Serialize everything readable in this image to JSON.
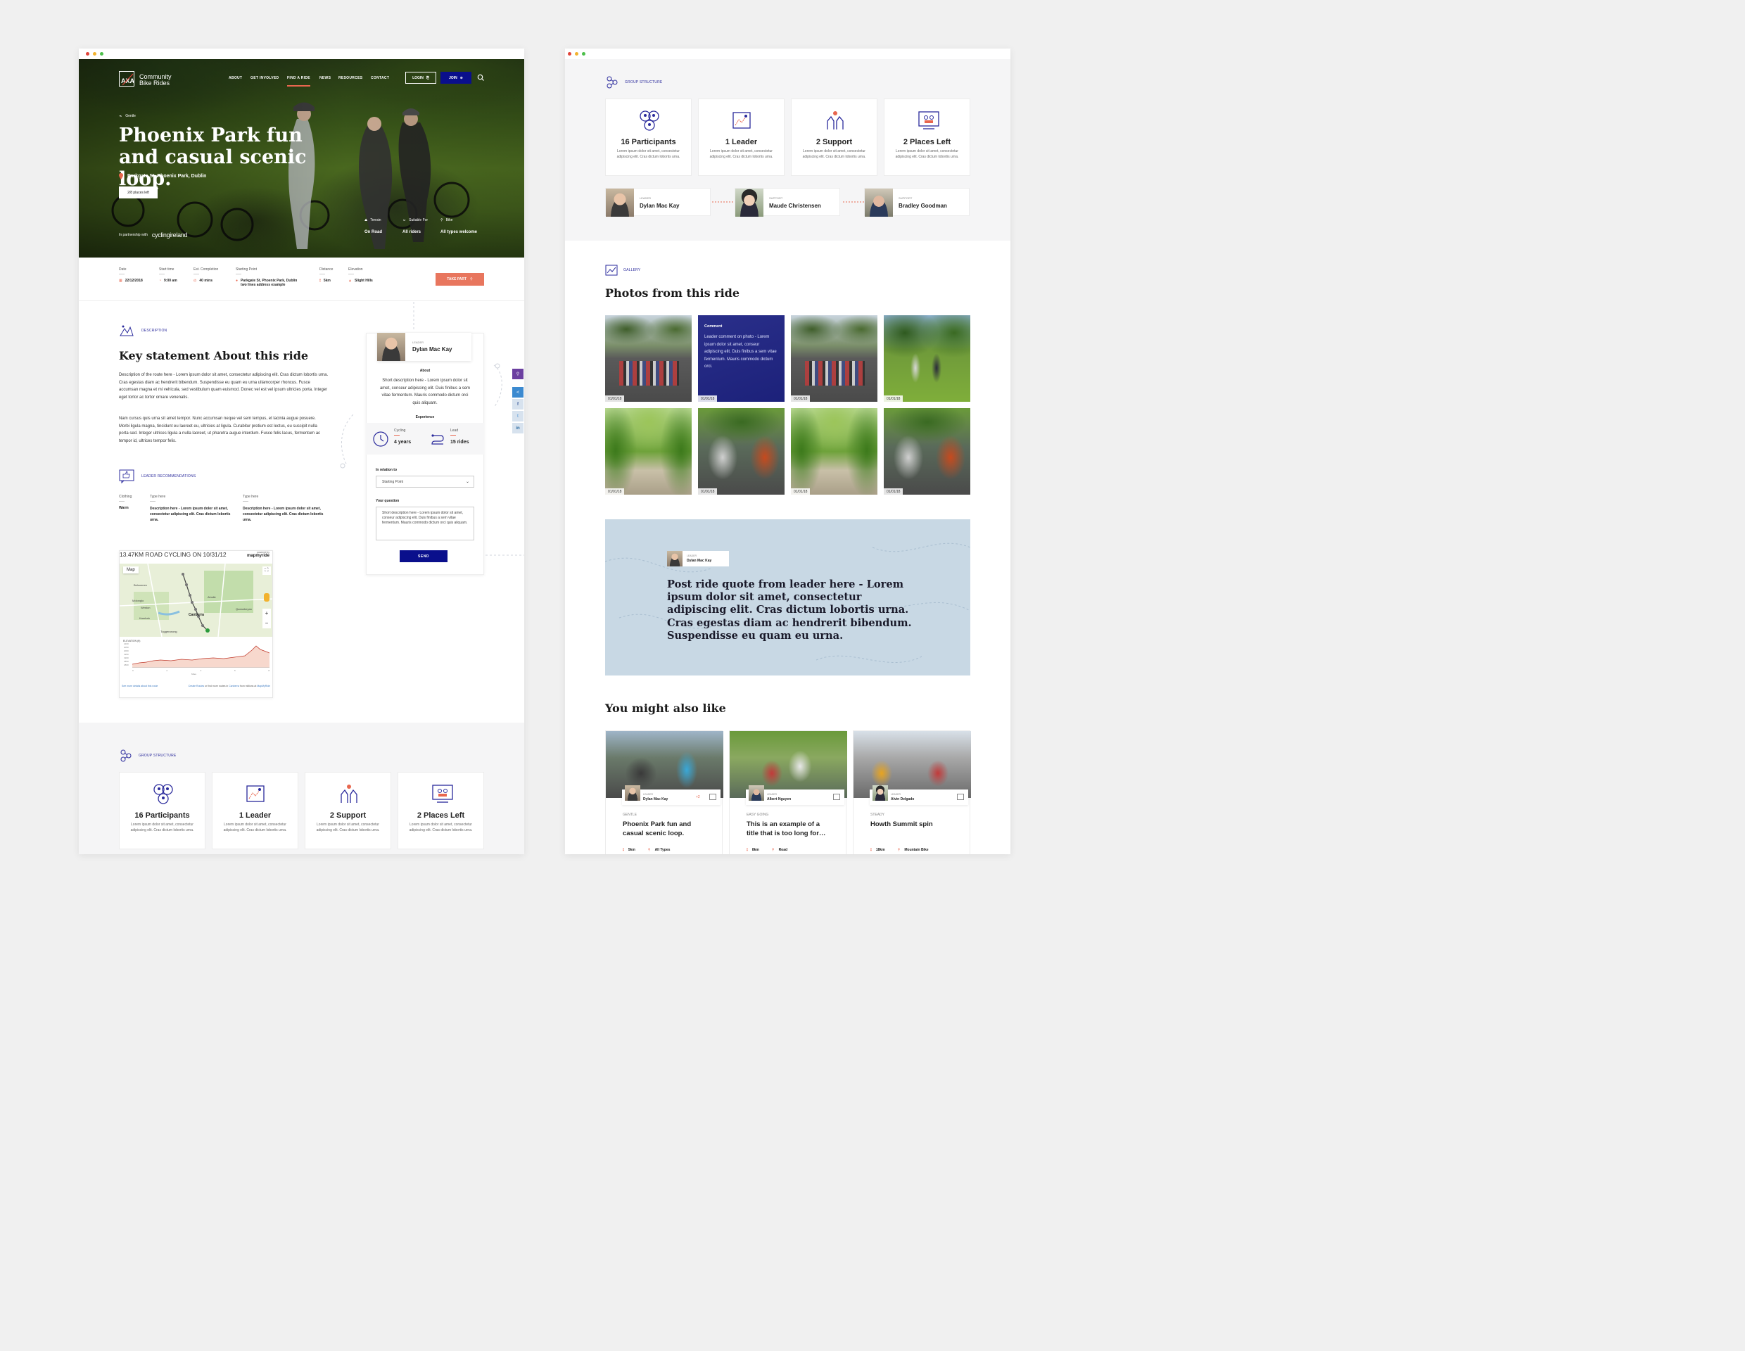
{
  "left": {
    "header": {
      "logo_line1": "Community",
      "logo_line2": "Bike Rides",
      "nav": [
        "ABOUT",
        "GET INVOLVED",
        "FIND A RIDE",
        "NEWS",
        "RESOURCES",
        "CONTACT"
      ],
      "login": "LOGIN",
      "join": "JOIN"
    },
    "hero": {
      "level": "Gentle",
      "title": "Phoenix Park fun and casual scenic loop.",
      "location": "Parkgate St, Phoenix Park, Dublin",
      "places": "2/8 places left",
      "partner_prefix": "In partnership with",
      "partner_name": "cyclingireland",
      "features": [
        {
          "label": "Terrain",
          "value": "On Road"
        },
        {
          "label": "Suitable For",
          "value": "All riders"
        },
        {
          "label": "Bike",
          "value": "All types welcome"
        }
      ]
    },
    "details": {
      "date": {
        "label": "Date",
        "value": "22/12/2018"
      },
      "start": {
        "label": "Start time",
        "value": "9:00 am"
      },
      "completion": {
        "label": "Est. Completion",
        "value": "40 mins"
      },
      "starting_point": {
        "label": "Starting Point",
        "value": "Parkgate St, Phoenix Park, Dublin",
        "value2": "two lines address example"
      },
      "distance": {
        "label": "Distance",
        "value": "5km"
      },
      "elevation": {
        "label": "Elevation",
        "value": "Slight Hills"
      },
      "take_part": "TAKE PART"
    },
    "description": {
      "tag": "DESCRIPTION",
      "heading": "Key statement About this ride",
      "para1": "Description of the route here - Lorem ipsum dolor sit amet, consectetur adipiscing elit. Cras dictum lobortis urna. Cras egestas diam ac hendrerit bibendum. Suspendisse eu quam eu urna ullamcorper rhoncus. Fusce accumsan magna et mi vehicula, sed vestibulum quam euismod. Donec vel est vel ipsum ultricies porta. Integer eget tortor ac tortor ornare venenatis.",
      "para2": "Nam cursus quis urna sit amet tempor. Nunc accumsan neque vel sem tempus, et lacinia augue posuere. Morbi ligula magna, tincidunt eu laoreet eu, ultricies at ligula. Curabitur pretium est lectus, eu suscipit nulla porta sed. Integer ultrices ligula a nulla laoreet, ut pharetra augue interdum. Fusce felis lacus, fermentum ac tempor id, ultrices tempor felis."
    },
    "recommendations": {
      "tag": "LEADER RECOMMENDATIONS",
      "cols": [
        {
          "label": "Clothing",
          "value": "Warm"
        },
        {
          "label": "Type here",
          "value": "Description here - Lorem ipsum dolor sit amet, consectetur adipiscing elit. Cras dictum lobortis urna."
        },
        {
          "label": "Type here",
          "value": "Description here - Lorem ipsum dolor sit amet, consectetur adipiscing elit. Cras dictum lobortis urna."
        }
      ]
    },
    "leader_card": {
      "role": "LEADER",
      "name": "Dylan Mac Kay",
      "about_title": "About",
      "about_text": "Short description here - Lorem ipsum dolor sit amet, conseur adipiscing elit. Duis finibus a sem vitae fermentum. Mauris commodo dictum orci quis aliquam.",
      "exp_title": "Experience",
      "cycling_label": "Cycling",
      "cycling_value": "4 years",
      "lead_label": "Lead",
      "lead_value": "15 rides",
      "relation_label": "In relation to",
      "relation_value": "Starting Point",
      "question_label": "Your question",
      "question_value": "Short description here - Lorem ipsum dolor sit amet, conseur adipiscing elit. Duis finibus a sem vitae fermentum. Mauris commodo dictum orci quis aliquam.",
      "send": "SEND"
    },
    "map": {
      "title": "13.47KM ROAD CYCLING ON 10/31/12",
      "powered": "powered by",
      "brand": "mapmyride",
      "map_tab": "Map",
      "elev_label": "ELEVATION (ft)",
      "elev_ticks": [
        "2100",
        "2050",
        "2000",
        "1950",
        "1900",
        "1850",
        "1800"
      ],
      "mile_ticks": [
        "0",
        "2",
        "4",
        "6",
        "8"
      ],
      "miles": "Miles",
      "footer_link1": "See more details about this route",
      "footer_link2": "Create Routes",
      "footer_text": "or find more routes in",
      "footer_link3": "Canberra",
      "footer_text2": "from millions at",
      "footer_link4": "MapMyRide",
      "places": [
        "Belconnen",
        "Ainslie",
        "Canberra",
        "Queanbeyan",
        "Tuggeranong",
        "Kambah",
        "Molonglo",
        "Weston"
      ]
    },
    "group": {
      "tag": "GROUP STRUCTURE",
      "cards": [
        {
          "title": "16 Participants",
          "desc": "Lorem ipsum dolor sit amet, consectetur adipiscing elit. Cras dictum lobortis urna."
        },
        {
          "title": "1 Leader",
          "desc": "Lorem ipsum dolor sit amet, consectetur adipiscing elit. Cras dictum lobortis urna."
        },
        {
          "title": "2 Support",
          "desc": "Lorem ipsum dolor sit amet, consectetur adipiscing elit. Cras dictum lobortis urna."
        },
        {
          "title": "2 Places Left",
          "desc": "Lorem ipsum dolor sit amet, consectetur adipiscing elit. Cras dictum lobortis urna."
        }
      ]
    }
  },
  "right": {
    "group": {
      "tag": "GROUP STRUCTURE",
      "cards": [
        {
          "title": "16 Participants",
          "desc": "Lorem ipsum dolor sit amet, consectetur adipiscing elit. Cras dictum lobortis urna."
        },
        {
          "title": "1 Leader",
          "desc": "Lorem ipsum dolor sit amet, consectetur adipiscing elit. Cras dictum lobortis urna."
        },
        {
          "title": "2 Support",
          "desc": "Lorem ipsum dolor sit amet, consectetur adipiscing elit. Cras dictum lobortis urna."
        },
        {
          "title": "2 Places Left",
          "desc": "Lorem ipsum dolor sit amet, consectetur adipiscing elit. Cras dictum lobortis urna."
        }
      ],
      "people": [
        {
          "role": "LEADER",
          "name": "Dylan Mac Kay"
        },
        {
          "role": "SUPPORT",
          "name": "Maude Christensen"
        },
        {
          "role": "SUPPORT",
          "name": "Bradley Goodman"
        }
      ]
    },
    "gallery": {
      "tag": "GALLERY",
      "heading": "Photos from this ride",
      "comment_title": "Comment",
      "comment_text": "Leader comment on photo - Lorem ipsum dolor sit amet, conseur adipiscing elit. Duis finibus a sem vitae fermentum. Mauris commodo dictum orci.",
      "dates": [
        "01/01/18",
        "01/01/18",
        "01/01/18",
        "01/01/18",
        "01/01/18",
        "01/01/18",
        "01/01/18",
        "01/01/18"
      ]
    },
    "quote": {
      "role": "LEADER",
      "name": "Dylan Mac Kay",
      "text": "Post ride quote from leader here - Lorem ipsum dolor sit amet, consectetur adipiscing elit. Cras dictum lobortis urna. Cras egestas diam ac hendrerit bibendum. Suspendisse eu quam eu urna."
    },
    "also": {
      "heading": "You might also like",
      "cards": [
        {
          "leader_role": "LEADER",
          "leader": "Dylan Mac Kay",
          "extra": "+2",
          "level": "GENTLE",
          "title": "Phoenix Park fun and casual scenic loop.",
          "distance": "5km",
          "bike": "All Types"
        },
        {
          "leader_role": "LEADER",
          "leader": "Albert Nguyen",
          "extra": "",
          "level": "EASY GOING",
          "title": "This is an example of a title that is too long for…",
          "distance": "8km",
          "bike": "Road"
        },
        {
          "leader_role": "LEADER",
          "leader": "Alvin Delgado",
          "extra": "",
          "level": "STEADY",
          "title": "Howth Summit spin",
          "distance": "18km",
          "bike": "Mountain Bike"
        }
      ]
    }
  },
  "colors": {
    "brand_navy": "#0a0f8c",
    "accent_coral": "#e8765e",
    "section_purple": "#2a2a9c",
    "quote_bg": "#c8d8e4"
  }
}
